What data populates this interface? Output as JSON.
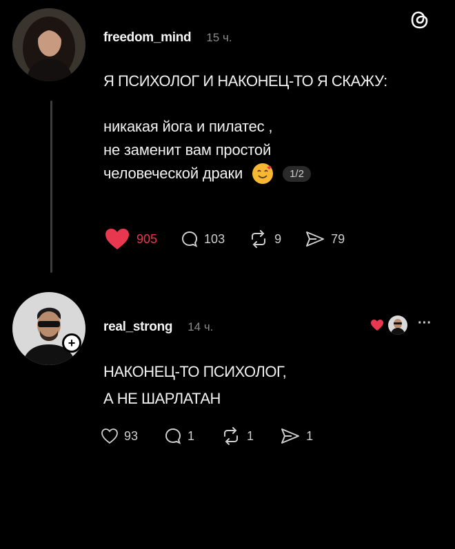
{
  "post": {
    "username": "freedom_mind",
    "time": "15 ч.",
    "headline": "Я ПСИХОЛОГ И НАКОНЕЦ-ТО Я СКАЖУ:",
    "lines": [
      "никакая йога и пилатес ,",
      "не заменит вам простой",
      "человеческой драки"
    ],
    "pager": "1/2",
    "stats": {
      "likes": "905",
      "replies": "103",
      "reposts": "9",
      "shares": "79"
    },
    "like_color": "#e8384f"
  },
  "reply": {
    "username": "real_strong",
    "time": "14 ч.",
    "plus_label": "+",
    "more_label": "···",
    "lines": [
      "НАКОНЕЦ-ТО ПСИХОЛОГ,",
      "А НЕ ШАРЛАТАН"
    ],
    "stats": {
      "likes": "93",
      "replies": "1",
      "reposts": "1",
      "shares": "1"
    }
  },
  "icons": {
    "app_logo": "threads-logo-icon",
    "like": "heart-icon",
    "reply": "comment-icon",
    "repost": "repost-icon",
    "share": "share-icon"
  }
}
